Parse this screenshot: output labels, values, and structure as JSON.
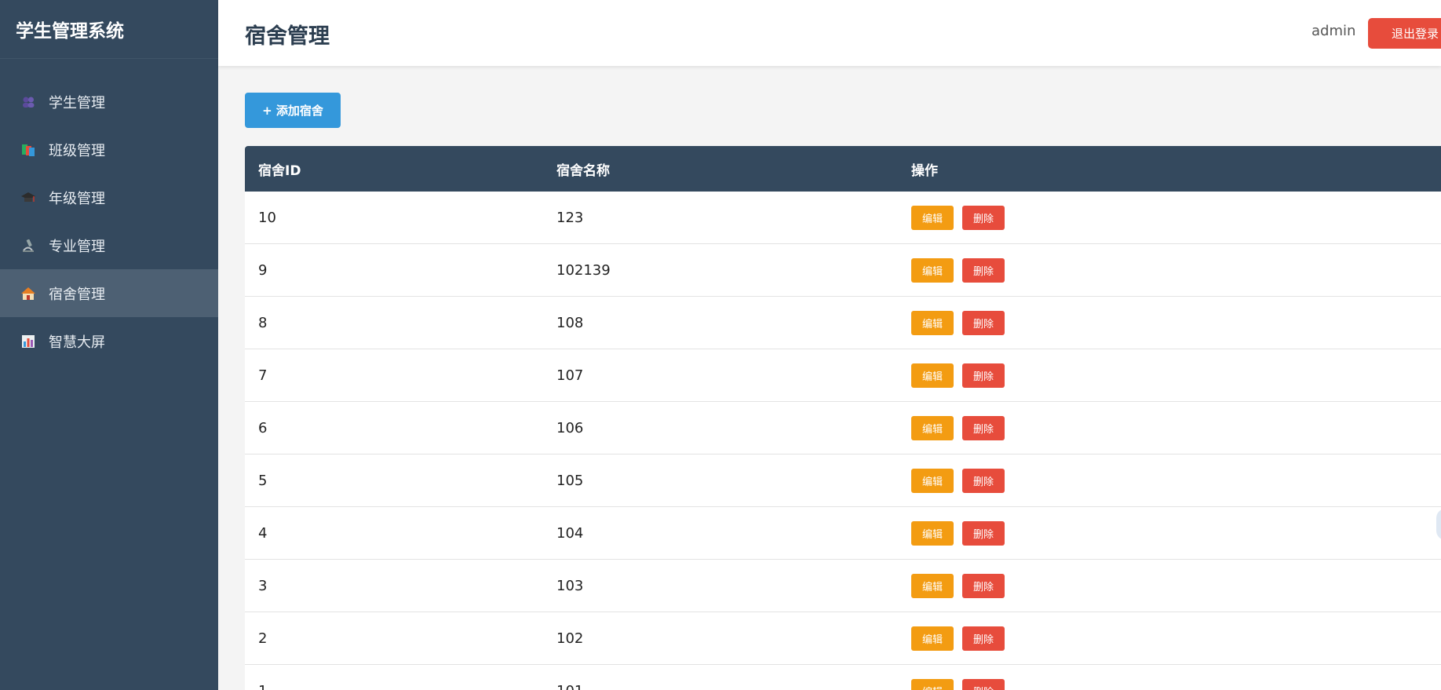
{
  "sidebar": {
    "brand": "学生管理系统",
    "items": [
      {
        "label": "学生管理",
        "icon": "students-icon"
      },
      {
        "label": "班级管理",
        "icon": "books-icon"
      },
      {
        "label": "年级管理",
        "icon": "graduation-cap-icon"
      },
      {
        "label": "专业管理",
        "icon": "microscope-icon"
      },
      {
        "label": "宿舍管理",
        "icon": "house-icon",
        "active": true
      },
      {
        "label": "智慧大屏",
        "icon": "bar-chart-icon"
      }
    ]
  },
  "header": {
    "title": "宿舍管理",
    "user": "admin",
    "logout_label": "退出登录"
  },
  "toolbar": {
    "add_label": "+ 添加宿舍"
  },
  "table": {
    "columns": [
      "宿舍ID",
      "宿舍名称",
      "操作"
    ],
    "rows": [
      {
        "id": "10",
        "name": "123"
      },
      {
        "id": "9",
        "name": "102139"
      },
      {
        "id": "8",
        "name": "108"
      },
      {
        "id": "7",
        "name": "107"
      },
      {
        "id": "6",
        "name": "106"
      },
      {
        "id": "5",
        "name": "105"
      },
      {
        "id": "4",
        "name": "104"
      },
      {
        "id": "3",
        "name": "103"
      },
      {
        "id": "2",
        "name": "102"
      },
      {
        "id": "1",
        "name": "101"
      }
    ],
    "edit_label": "编辑",
    "delete_label": "删除"
  },
  "colors": {
    "sidebar_bg": "#34495e",
    "primary": "#3498db",
    "danger": "#e74c3c",
    "warning": "#f39c12"
  }
}
